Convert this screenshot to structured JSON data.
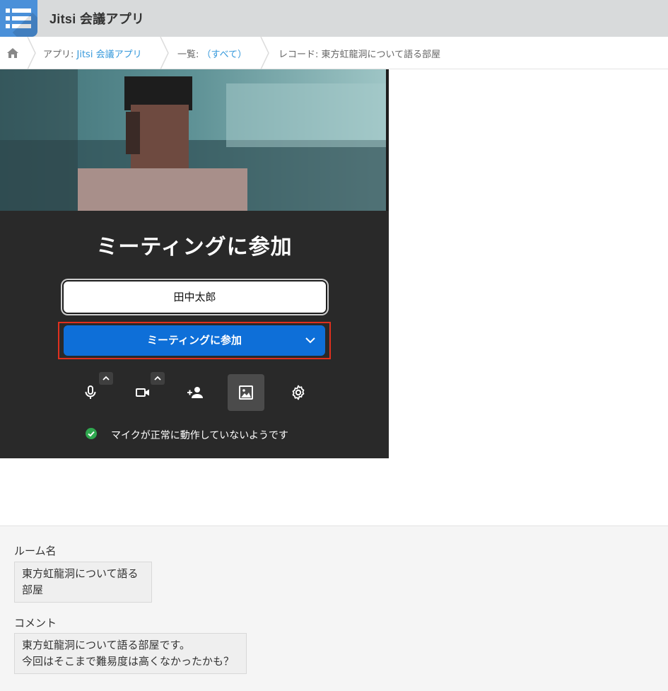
{
  "app": {
    "title": "Jitsi 会議アプリ",
    "icon": "list-icon"
  },
  "breadcrumb": {
    "home_icon": "home-icon",
    "app_prefix": "アプリ: ",
    "app_link": "Jitsi 会議アプリ",
    "list_prefix": "一覧: ",
    "list_link": "（すべて）",
    "record": "レコード: 東方虹龍洞について語る部屋"
  },
  "meeting": {
    "title": "ミーティングに参加",
    "name_value": "田中太郎",
    "join_label": "ミーティングに参加",
    "toolbar": [
      "microphone-icon",
      "camera-icon",
      "invite-icon",
      "background-icon",
      "settings-icon"
    ],
    "status_text": "マイクが正常に動作していないようです"
  },
  "fields": {
    "room_label": "ルーム名",
    "room_line1": "東方虹龍洞について語る",
    "room_line2": "部屋",
    "comment_label": "コメント",
    "comment_line1": "東方虹龍洞について語る部屋です。",
    "comment_line2": "今回はそこまで難易度は高くなかったかも？"
  },
  "colors": {
    "accent": "#0e6fd8",
    "highlight": "#e0301e",
    "panel": "#292929",
    "link": "#3498db"
  }
}
